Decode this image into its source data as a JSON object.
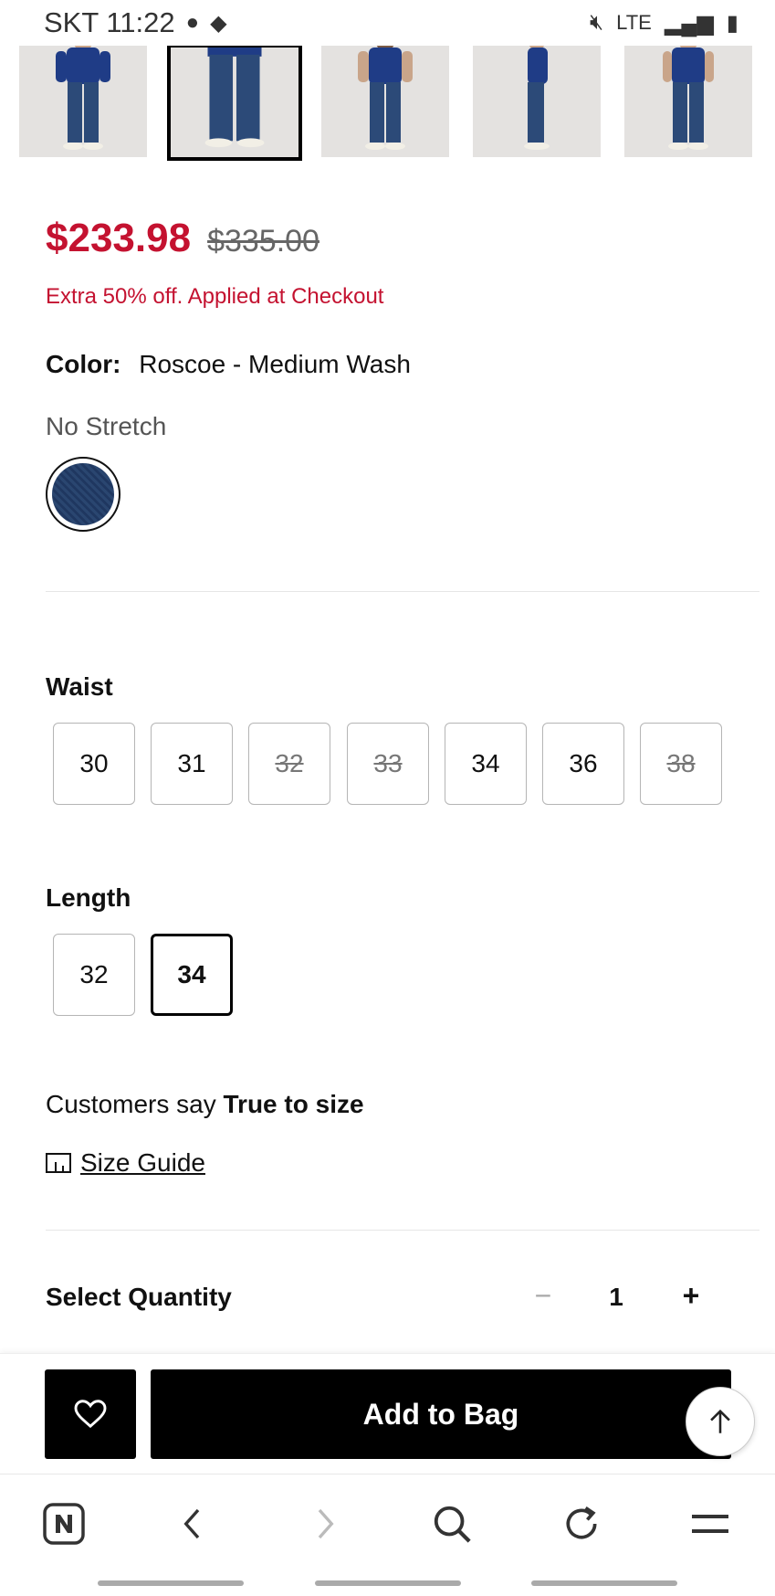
{
  "status_bar": {
    "carrier_time": "SKT 11:22",
    "network": "LTE"
  },
  "product": {
    "sale_price": "$233.98",
    "original_price": "$335.00",
    "promo_text": "Extra 50% off. Applied at Checkout",
    "color_label": "Color:",
    "color_value": "Roscoe - Medium Wash",
    "stretch": "No Stretch",
    "swatch_color": "#2a4670",
    "selected_thumbnail": 2
  },
  "waist": {
    "title": "Waist",
    "options": [
      {
        "label": "30",
        "available": true
      },
      {
        "label": "31",
        "available": true
      },
      {
        "label": "32",
        "available": false
      },
      {
        "label": "33",
        "available": false
      },
      {
        "label": "34",
        "available": true
      },
      {
        "label": "36",
        "available": true
      },
      {
        "label": "38",
        "available": false
      }
    ]
  },
  "length": {
    "title": "Length",
    "options": [
      {
        "label": "32",
        "available": true,
        "selected": false
      },
      {
        "label": "34",
        "available": true,
        "selected": true
      }
    ]
  },
  "fit": {
    "prefix": "Customers say",
    "value": "True to size"
  },
  "size_guide": {
    "label": "Size Guide"
  },
  "quantity": {
    "label": "Select Quantity",
    "minus": "−",
    "value": "1",
    "plus": "+"
  },
  "actions": {
    "add_to_bag": "Add to Bag"
  },
  "colors": {
    "sale": "#c41230",
    "button": "#000000"
  }
}
